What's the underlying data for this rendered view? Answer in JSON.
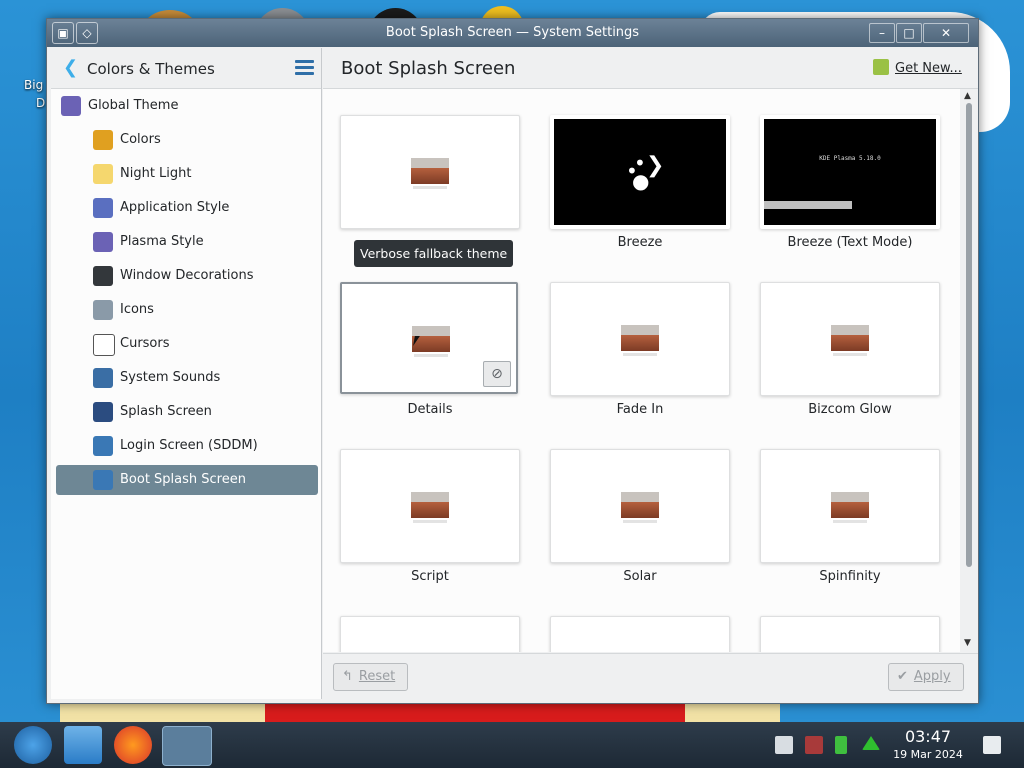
{
  "window": {
    "title": "Boot Splash Screen — System Settings",
    "buttons": {
      "minimize": "–",
      "maximize": "□",
      "close": "✕"
    }
  },
  "sidebar": {
    "back_icon": "back-arrow-icon",
    "title": "Colors & Themes",
    "menu_icon": "hamburger-menu-icon",
    "items": [
      {
        "label": "Global Theme",
        "icon": "global-theme-icon",
        "color": "#6b62b5",
        "level": 0
      },
      {
        "label": "Colors",
        "icon": "color-wheel-icon",
        "color": "#e0a020",
        "level": 1
      },
      {
        "label": "Night Light",
        "icon": "light-bulb-icon",
        "color": "#f5d76e",
        "level": 1
      },
      {
        "label": "Application Style",
        "icon": "application-style-icon",
        "color": "#5a6fc0",
        "level": 1
      },
      {
        "label": "Plasma Style",
        "icon": "plasma-style-icon",
        "color": "#6b62b5",
        "level": 1
      },
      {
        "label": "Window Decorations",
        "icon": "window-decorations-icon",
        "color": "#33373b",
        "level": 1
      },
      {
        "label": "Icons",
        "icon": "icons-icon",
        "color": "#8a9aa8",
        "level": 1
      },
      {
        "label": "Cursors",
        "icon": "cursor-icon",
        "color": "#ffffff",
        "level": 1
      },
      {
        "label": "System Sounds",
        "icon": "question-sound-icon",
        "color": "#3a6ea5",
        "level": 1
      },
      {
        "label": "Splash Screen",
        "icon": "splash-screen-icon",
        "color": "#2b4c80",
        "level": 1
      },
      {
        "label": "Login Screen (SDDM)",
        "icon": "login-screen-icon",
        "color": "#3a78b5",
        "level": 1
      },
      {
        "label": "Boot Splash Screen",
        "icon": "boot-splash-icon",
        "color": "#3a78b5",
        "level": 1,
        "selected": true
      }
    ]
  },
  "content": {
    "title": "Boot Splash Screen",
    "get_new": {
      "label": "Get New...",
      "icon": "get-new-icon"
    },
    "tooltip": "Verbose fallback theme",
    "cards": [
      {
        "label": "",
        "preview": "placeholder"
      },
      {
        "label": "Breeze",
        "preview": "breeze"
      },
      {
        "label": "Breeze (Text Mode)",
        "preview": "text-mode",
        "preview_text": "KDE Plasma 5.18.0"
      },
      {
        "label": "Details",
        "preview": "placeholder",
        "selected": true,
        "remove_icon": "remove-icon"
      },
      {
        "label": "Fade In",
        "preview": "placeholder"
      },
      {
        "label": "Bizcom Glow",
        "preview": "placeholder"
      },
      {
        "label": "Script",
        "preview": "placeholder"
      },
      {
        "label": "Solar",
        "preview": "placeholder"
      },
      {
        "label": "Spinfinity",
        "preview": "placeholder"
      },
      {
        "label": "",
        "preview": "placeholder"
      },
      {
        "label": "",
        "preview": "placeholder"
      },
      {
        "label": "",
        "preview": "placeholder"
      }
    ],
    "footer": {
      "reset": {
        "label": "Reset",
        "icon": "reset-icon"
      },
      "apply": {
        "label": "Apply",
        "icon": "checkmark-icon"
      }
    }
  },
  "taskbar": {
    "time": "03:47",
    "date": "19 Mar 2024",
    "apps": [
      "start-menu-icon",
      "file-manager-icon",
      "firefox-icon",
      "system-settings-icon"
    ],
    "tray": [
      "clipboard-icon",
      "network-icon",
      "battery-icon",
      "updates-icon",
      "notifications-icon"
    ]
  },
  "desktop": {
    "icons": [
      {
        "label": "Big",
        "sub": "D"
      }
    ]
  },
  "colors": {
    "accent": "#3daee9",
    "selection": "#6e8795",
    "titlebar": "#5b7086"
  }
}
